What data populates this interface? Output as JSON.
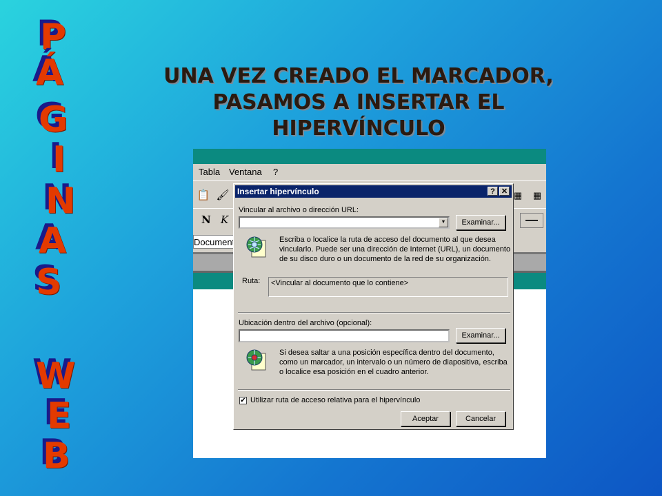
{
  "side_letters": [
    "P",
    "Á",
    "G",
    "I",
    "N",
    "A",
    "S",
    "W",
    "E",
    "B"
  ],
  "slide_title": "UNA VEZ CREADO EL MARCADOR, PASAMOS A INSERTAR EL HIPERVÍNCULO",
  "app": {
    "menu": [
      "Tabla",
      "Ventana",
      "?"
    ],
    "doc_name": "Documento"
  },
  "dialog": {
    "title": "Insertar hipervínculo",
    "help_btn": "?",
    "close_btn": "✕",
    "url_label": "Vincular al archivo o dirección URL:",
    "url_value": "",
    "browse1": "Examinar...",
    "hint1": "Escriba o localice la ruta de acceso del documento al que desea vincularlo. Puede ser una dirección de Internet (URL), un documento de su disco duro o un documento de la red de su organización.",
    "ruta_label": "Ruta:",
    "ruta_value": "<Vincular al documento que lo contiene>",
    "loc_label": "Ubicación dentro del archivo (opcional):",
    "loc_value": "",
    "browse2": "Examinar...",
    "hint2": "Si desea saltar a una posición específica dentro del documento, como un marcador, un intervalo o un número de diapositiva, escriba o localice esa posición en el cuadro anterior.",
    "checkbox_label": "Utilizar ruta de acceso relativa para el hipervínculo",
    "checkbox_checked": true,
    "ok": "Aceptar",
    "cancel": "Cancelar"
  }
}
